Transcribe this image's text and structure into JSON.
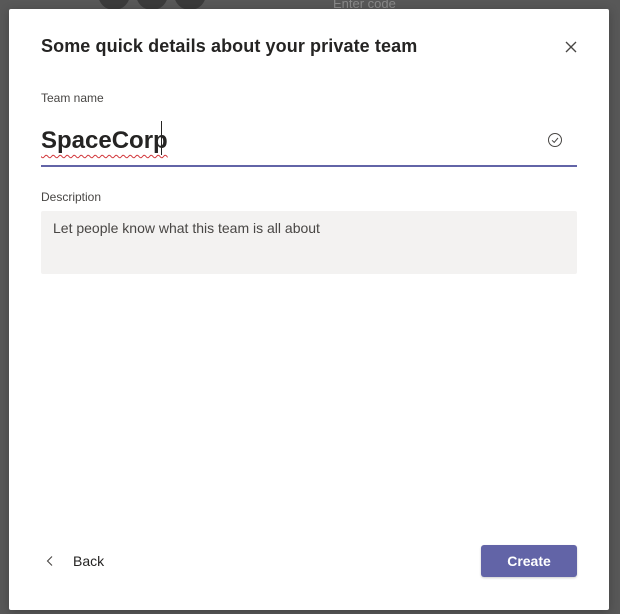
{
  "background": {
    "hint_text": "Enter code"
  },
  "dialog": {
    "title": "Some quick details about your private team",
    "close_icon": "close-icon"
  },
  "team_name": {
    "label": "Team name",
    "value": "SpaceCorp",
    "status_icon": "check-circle-icon"
  },
  "description": {
    "label": "Description",
    "placeholder": "Let people know what this team is all about",
    "value": ""
  },
  "footer": {
    "back_label": "Back",
    "back_icon": "chevron-left-icon",
    "create_label": "Create"
  },
  "colors": {
    "accent": "#6264a7",
    "spellcheck": "#d13438",
    "field_background": "#f3f2f1"
  }
}
